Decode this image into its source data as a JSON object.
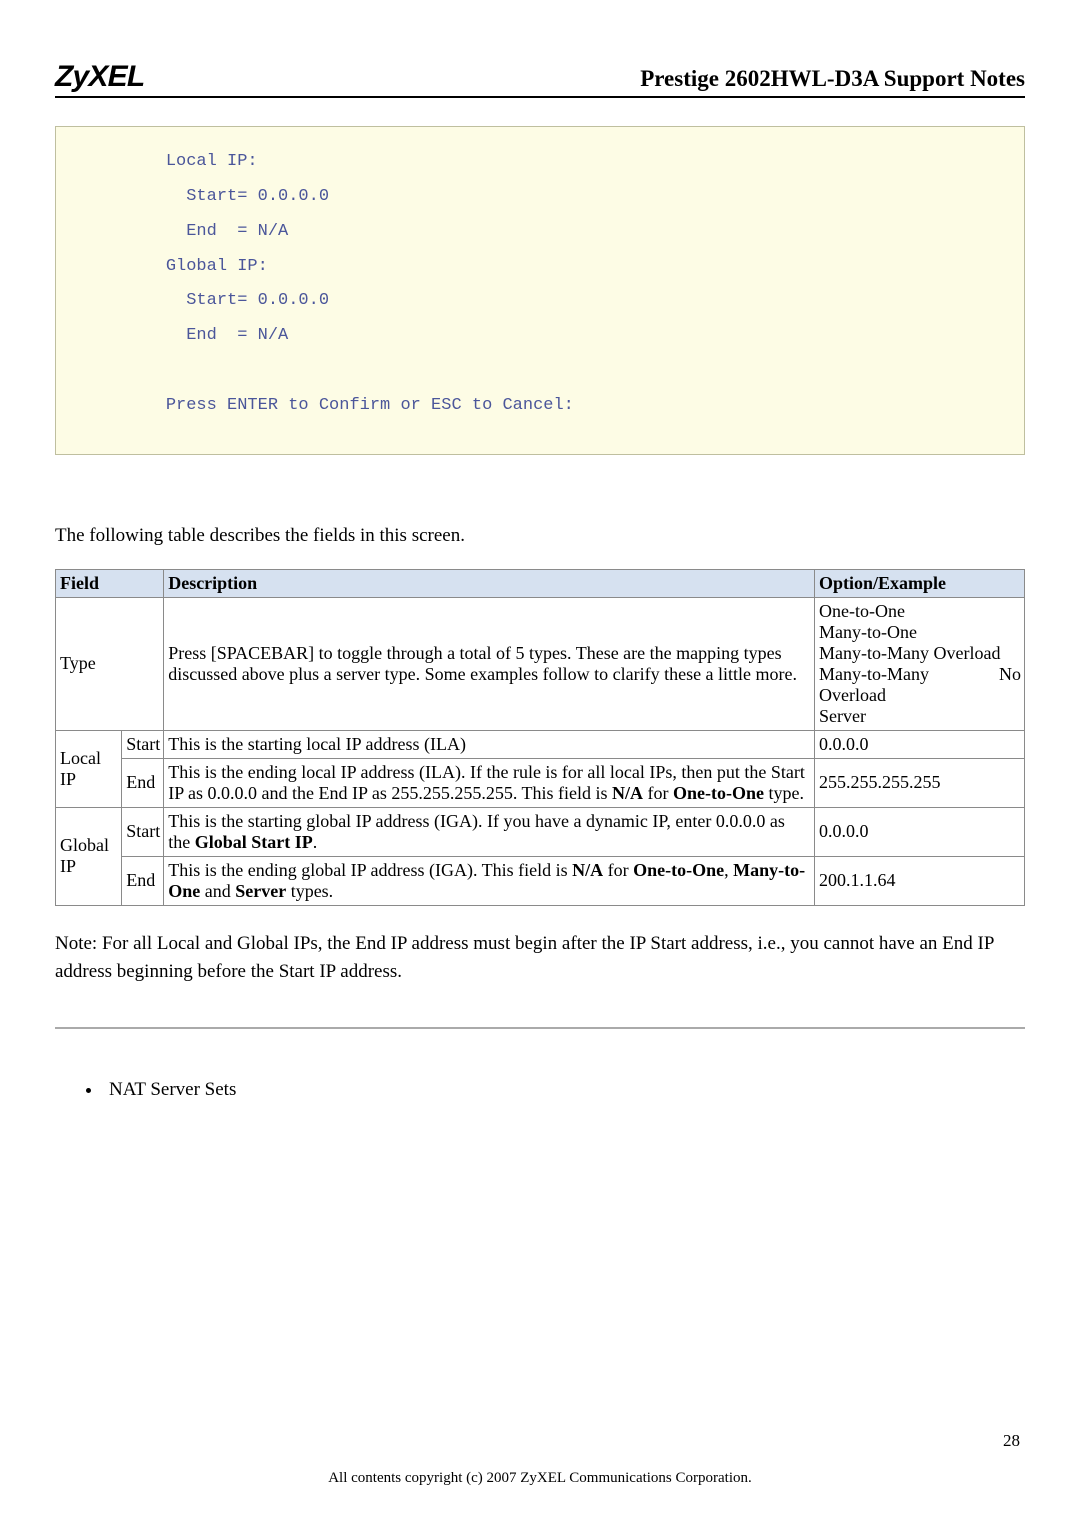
{
  "header": {
    "logo": "ZyXEL",
    "title": "Prestige 2602HWL-D3A Support Notes"
  },
  "code_block": "         Local IP:\n           Start= 0.0.0.0\n           End  = N/A\n         Global IP:\n           Start= 0.0.0.0\n           End  = N/A\n\n         Press ENTER to Confirm or ESC to Cancel:",
  "intro": "The following table describes the fields in this screen.",
  "table": {
    "h1": "Field",
    "h2": "Description",
    "h3": "Option/Example",
    "type_label": "Type",
    "type_desc": "Press [SPACEBAR] to toggle through a total of 5 types. These are the mapping types discussed above plus a server type. Some examples follow to clarify these a little more.",
    "type_opt_1": "One-to-One",
    "type_opt_2": "Many-to-One",
    "type_opt_3": "Many-to-Many Overload",
    "type_opt_4a": "Many-to-Many",
    "type_opt_4b": "No",
    "type_opt_5": "Overload",
    "type_opt_6": "Server",
    "local_ip_label": "Local IP",
    "start_label": "Start",
    "end_label": "End",
    "local_start_desc": "This is the starting local IP address (ILA)",
    "local_start_opt": "0.0.0.0",
    "local_end_desc_p1": "This is the ending local IP address (ILA). If the rule is for all local IPs, then put the Start IP as 0.0.0.0 and the End IP as 255.255.255.255. This field is ",
    "local_end_desc_b1": "N/A",
    "local_end_desc_p2": " for ",
    "local_end_desc_b2": "One-to-One",
    "local_end_desc_p3": " type.",
    "local_end_opt": "255.255.255.255",
    "global_ip_label": "Global IP",
    "global_start_desc_p1": "This is the starting global IP address (IGA). If you have a dynamic IP, enter 0.0.0.0 as the ",
    "global_start_desc_b1": "Global Start IP",
    "global_start_desc_p2": ".",
    "global_start_opt": "0.0.0.0",
    "global_end_desc_p1": "This is the ending global IP address (IGA). This field is ",
    "global_end_desc_b1": "N/A",
    "global_end_desc_p2": " for ",
    "global_end_desc_b2": "One-to-One",
    "global_end_desc_p3": ", ",
    "global_end_desc_b3": "Many-to-One",
    "global_end_desc_p4": " and ",
    "global_end_desc_b4": "Server",
    "global_end_desc_p5": " types.",
    "global_end_opt": "200.1.1.64"
  },
  "note": "Note: For all Local and Global IPs, the End IP address must begin after the IP Start address, i.e., you cannot have an End IP address beginning before the Start IP address.",
  "bullet1": "NAT Server Sets",
  "footer_text": "All contents copyright (c) 2007 ZyXEL Communications Corporation.",
  "page_number": "28"
}
